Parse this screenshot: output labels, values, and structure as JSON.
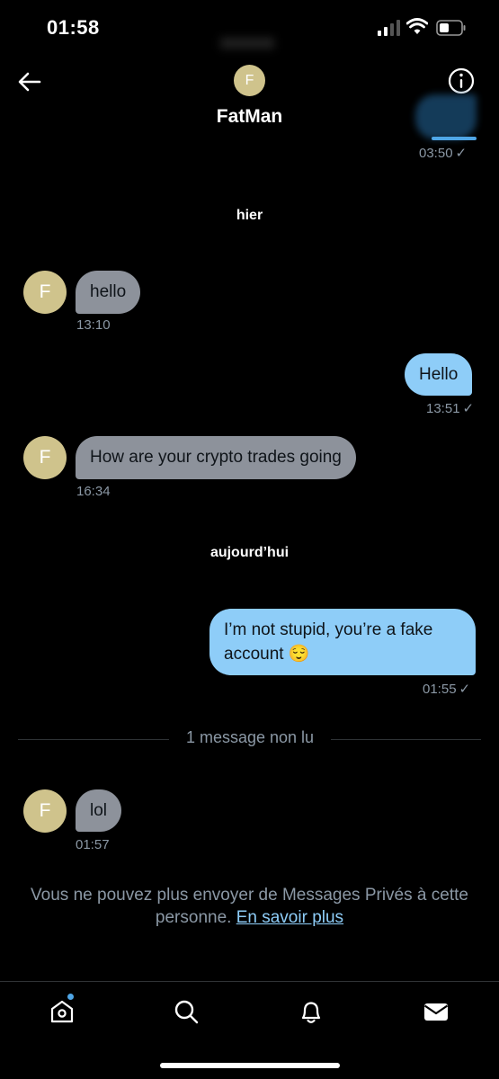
{
  "status_bar": {
    "time": "01:58"
  },
  "header": {
    "avatar_initial": "F",
    "title": "FatMan"
  },
  "messages": {
    "top_time": "03:50",
    "day1": "hier",
    "m1": {
      "avatar": "F",
      "text": "hello",
      "time": "13:10"
    },
    "m2": {
      "text": "Hello",
      "time": "13:51"
    },
    "m3": {
      "avatar": "F",
      "text": "How are your crypto trades going",
      "time": "16:34"
    },
    "day2": "aujourd’hui",
    "m4": {
      "text_line1": "I’m not stupid, you’re a fake",
      "text_line2": "account 😌",
      "time": "01:55"
    },
    "unread": "1 message non lu",
    "m5": {
      "avatar": "F",
      "text": "lol",
      "time": "01:57"
    },
    "read_mark": "✓"
  },
  "notice": {
    "text": "Vous ne pouvez plus envoyer de Messages Privés à cette personne.",
    "link": "En savoir plus"
  },
  "icons": [
    "back-arrow-icon",
    "info-icon",
    "home-icon",
    "search-icon",
    "bell-icon",
    "mail-icon"
  ],
  "colors": {
    "incoming_bubble": "#8d929b",
    "outgoing_bubble": "#8ecdf8",
    "avatar": "#cfc38c",
    "link": "#8ecdf8",
    "notification_dot": "#4fa6e6"
  }
}
